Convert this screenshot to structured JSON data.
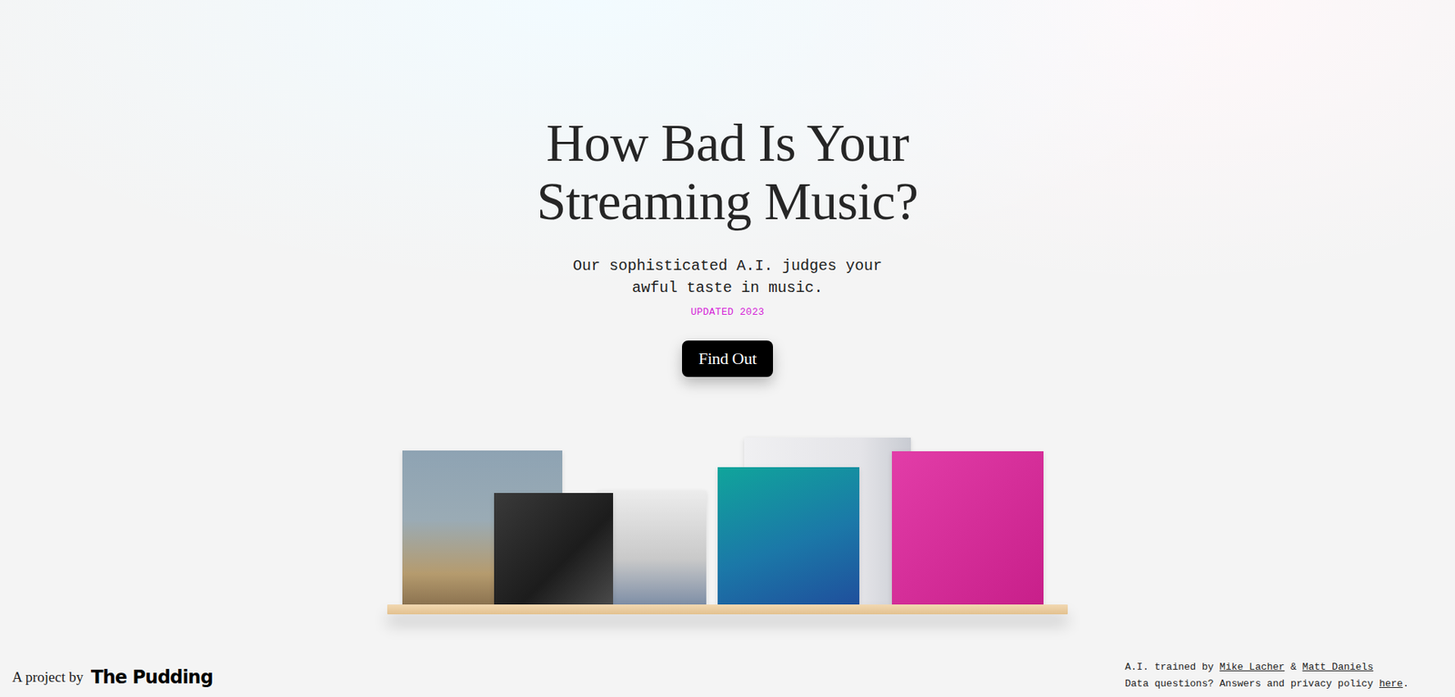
{
  "title": [
    "How Bad Is Your",
    "Streaming Music?"
  ],
  "subtitle": [
    "Our sophisticated A.I. judges your",
    "awful taste in music."
  ],
  "badge": "UPDATED 2023",
  "button": "Find Out",
  "footer": {
    "label": "A project by",
    "logo": "The Pudding",
    "credits": {
      "prefix": "A.I. trained by",
      "authors": [
        "Mike Lacher",
        "Matt Daniels"
      ],
      "joiner": "&",
      "privacy": "Data questions? Answers and privacy policy",
      "link": "here",
      "end": "."
    }
  }
}
